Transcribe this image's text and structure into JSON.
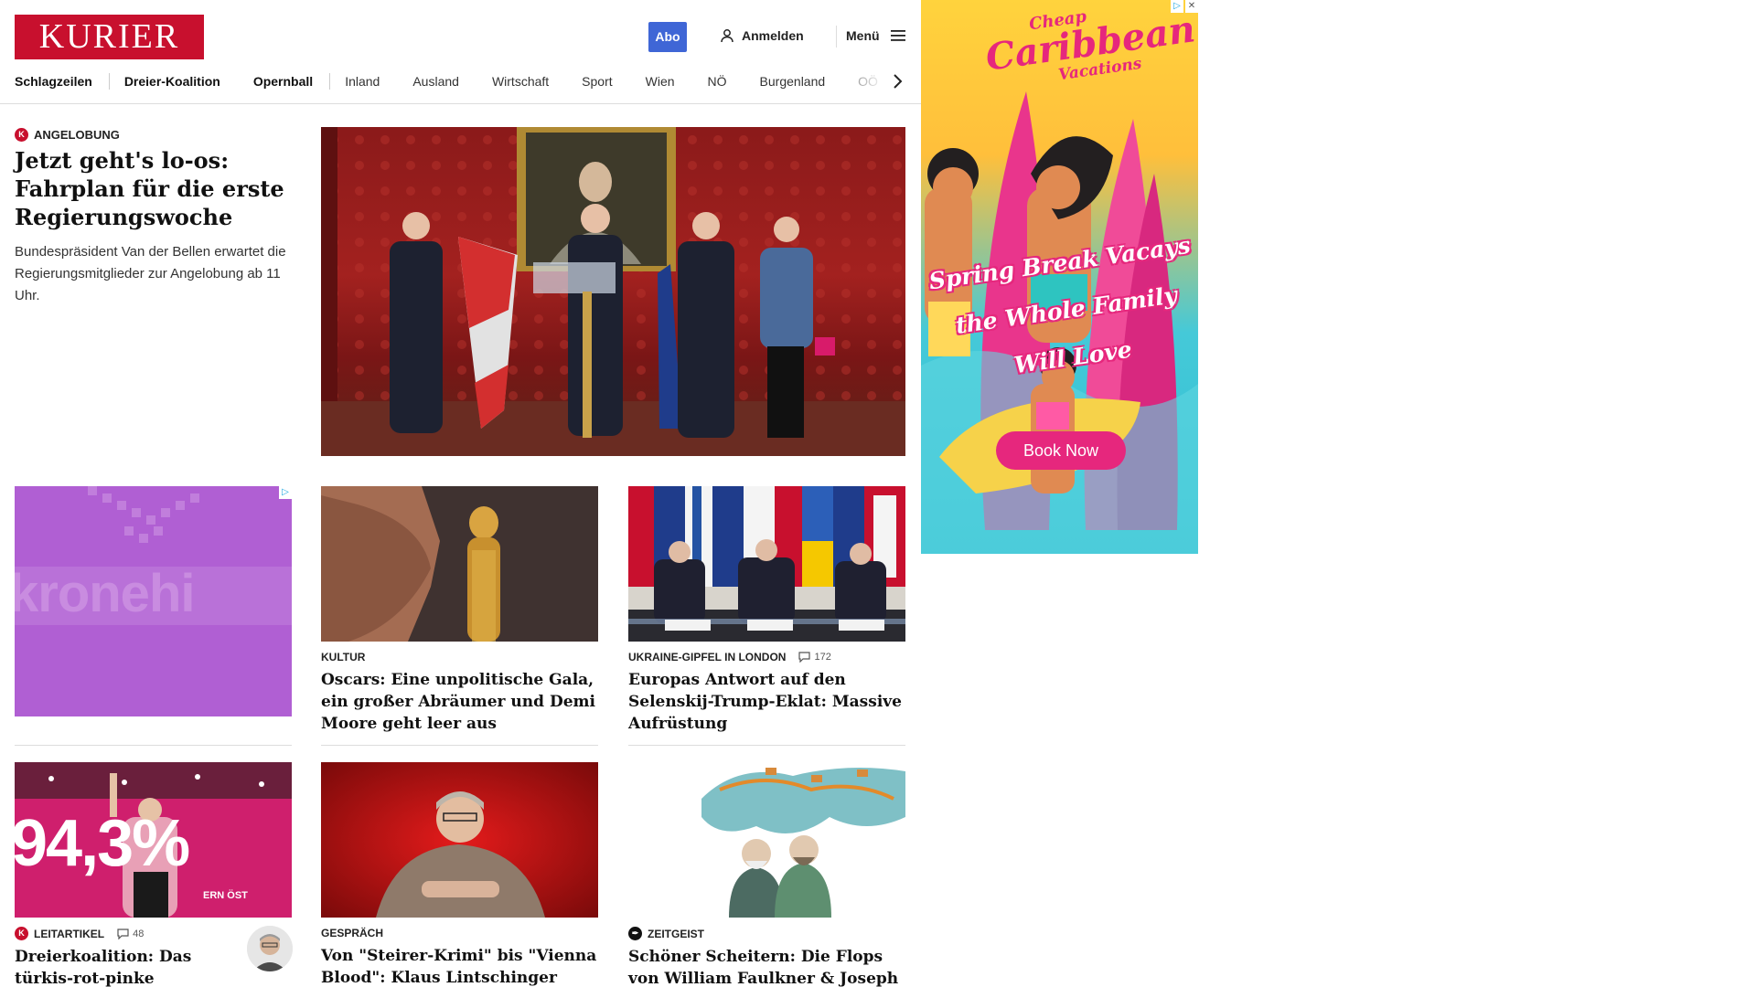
{
  "header": {
    "logo": "KURIER",
    "abo_label": "Abo",
    "login_label": "Anmelden",
    "menu_label": "Menü"
  },
  "nav": {
    "items": [
      "Schlagzeilen",
      "Dreier-Koalition",
      "Opernball",
      "Inland",
      "Ausland",
      "Wirtschaft",
      "Sport",
      "Wien",
      "NÖ",
      "Burgenland",
      "OÖ"
    ]
  },
  "lead": {
    "kicker": "ANGELOBUNG",
    "title": "Jetzt geht's lo-os: Fahrplan für die erste Regierungswoche",
    "teaser": "Bundespräsident Van der Bellen erwartet die Regierungsmitglieder zur Angelobung ab 11 Uhr."
  },
  "ad_small": {
    "text": "kronehi"
  },
  "cards": [
    {
      "kicker": "KULTUR",
      "title": "Oscars: Eine unpolitische Gala, ein großer Abräumer und Demi Moore geht leer aus"
    },
    {
      "kicker": "UKRAINE-GIPFEL IN LONDON",
      "comments": "172",
      "title": "Europas Antwort auf den Selenskij-Trump-Eklat: Massive Aufrüstung"
    },
    {
      "kicker": "LEITARTIKEL",
      "comments": "48",
      "title": "Dreierkoalition: Das türkis-rot-pinke Abenteuer",
      "image_text": "94,3%",
      "image_subtext": "ERN ÖST"
    },
    {
      "kicker": "GESPRÄCH",
      "title": "Von \"Steirer-Krimi\" bis \"Vienna Blood\": Klaus Lintschinger verlässt ORF"
    },
    {
      "kicker": "ZEITGEIST",
      "title": "Schöner Scheitern: Die Flops von William Faulkner & Joseph Conrad"
    }
  ],
  "ad_right": {
    "title_top": "Cheap",
    "title_main": "Caribbean",
    "title_sub": "Vacations",
    "headline": [
      "Spring Break Vacays",
      "the Whole Family",
      "Will Love"
    ],
    "cta": "Book Now"
  },
  "colors": {
    "brand": "#c8102e",
    "abo": "#3f66d6",
    "ad_purple": "#b05fd3",
    "cta_pink": "#e6277d"
  }
}
